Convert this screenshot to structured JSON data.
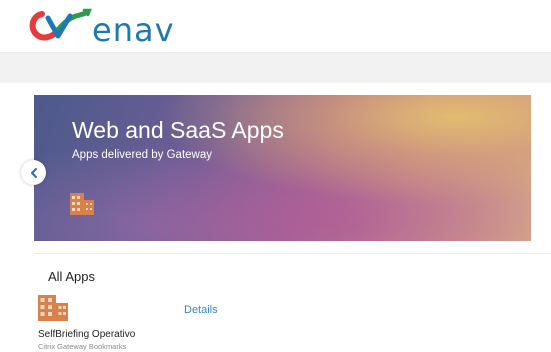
{
  "header": {
    "brand_text": "enav",
    "brand_colors": {
      "red": "#e53b3b",
      "green": "#2c9b4b",
      "blue": "#1e78b4"
    }
  },
  "banner": {
    "title": "Web and SaaS Apps",
    "subtitle": "Apps delivered by Gateway",
    "icon": "building-icon",
    "nav_icon": "chevron-left-icon"
  },
  "apps_section": {
    "title": "All Apps",
    "apps": [
      {
        "name": "SelfBriefing Operativo",
        "type": "Citrix Gateway Bookmarks",
        "details_label": "Details",
        "icon": "building-icon"
      }
    ]
  },
  "colors": {
    "accent": "#3a86c8",
    "icon_orange": "#d9814a"
  }
}
